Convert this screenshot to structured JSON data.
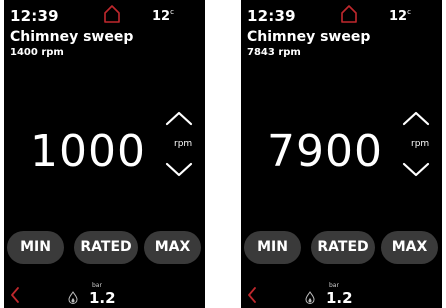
{
  "colors": {
    "background": "#000000",
    "text": "#ffffff",
    "accent": "#c0282d",
    "pill": "#3a3a3a",
    "page": "#ffffff"
  },
  "icons": {
    "home": "home-icon",
    "up": "chevron-up-icon",
    "down": "chevron-down-icon",
    "back": "back-arrow-icon",
    "flame": "flame-icon"
  },
  "screens": [
    {
      "time": "12:39",
      "temperature": "12",
      "temperature_unit": "c",
      "title": "Chimney sweep",
      "current_rpm": "1400 rpm",
      "setpoint": "1000",
      "setpoint_unit": "rpm",
      "buttons": {
        "min": "MIN",
        "rated": "RATED",
        "max": "MAX"
      },
      "pressure_label": "bar",
      "pressure_value": "1.2"
    },
    {
      "time": "12:39",
      "temperature": "12",
      "temperature_unit": "c",
      "title": "Chimney sweep",
      "current_rpm": "7843 rpm",
      "setpoint": "7900",
      "setpoint_unit": "rpm",
      "buttons": {
        "min": "MIN",
        "rated": "RATED",
        "max": "MAX"
      },
      "pressure_label": "bar",
      "pressure_value": "1.2"
    }
  ]
}
